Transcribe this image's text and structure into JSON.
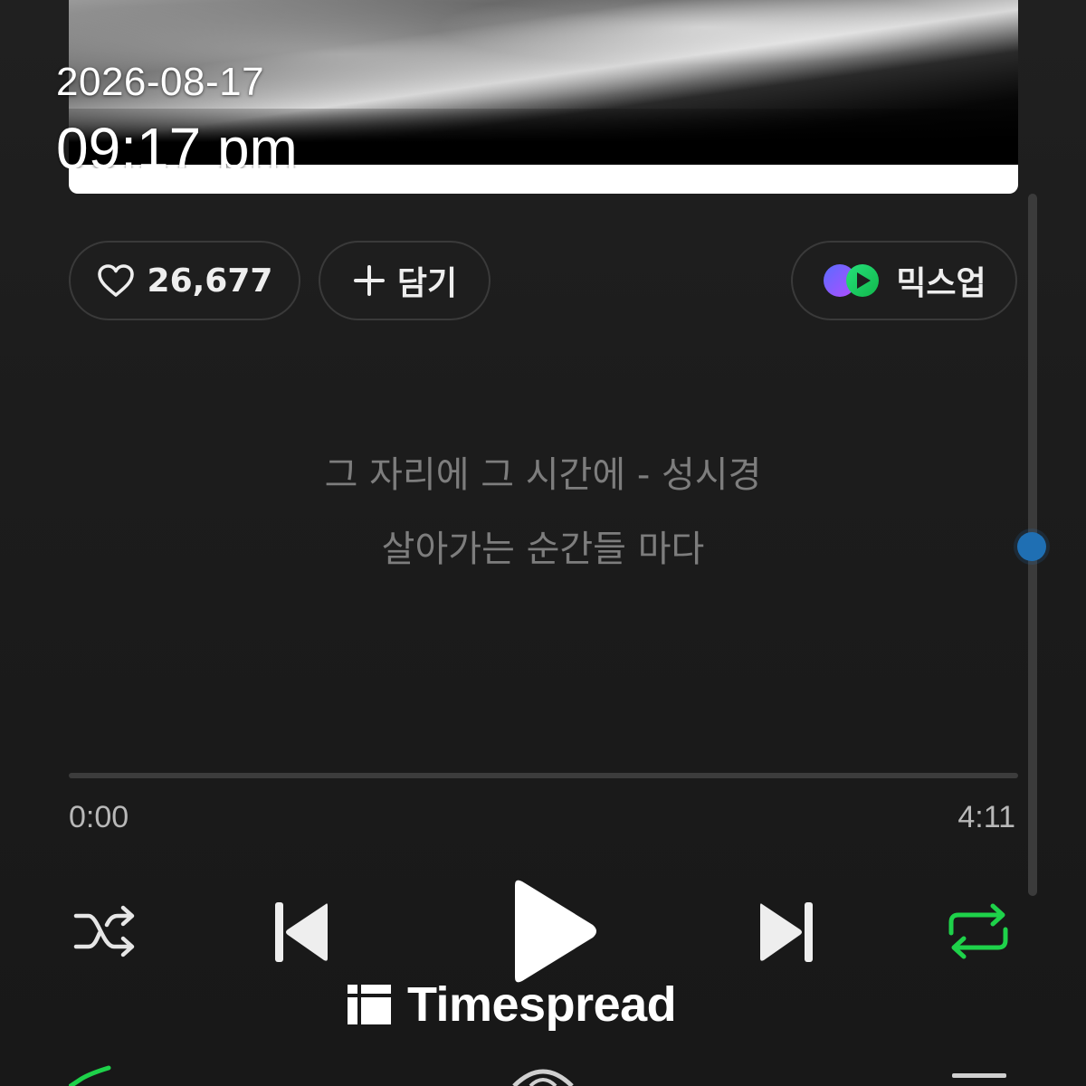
{
  "overlay": {
    "date": "2026-08-17",
    "time": "09:17 pm"
  },
  "actions": {
    "like_count": "26,677",
    "add_label": "담기",
    "mixup_label": "믹스업"
  },
  "lyrics": {
    "line1": "그 자리에 그 시간에 - 성시경",
    "line2": "살아가는 순간들 마다"
  },
  "playback": {
    "elapsed": "0:00",
    "total": "4:11",
    "progress": 0,
    "shuffle": false,
    "repeat": true
  },
  "watermark": {
    "text": "Timespread"
  },
  "colors": {
    "background": "#1b1b1b",
    "accent_green": "#1ed24a",
    "lyrics_text": "#7d7d7d",
    "scroll_knob": "#1f6fb3"
  },
  "icons": {
    "like": "heart-icon",
    "add": "plus-icon",
    "mixup": "mixup-logo-icon",
    "shuffle": "shuffle-icon",
    "prev": "skip-previous-icon",
    "play": "play-icon",
    "next": "skip-next-icon",
    "repeat": "repeat-icon"
  }
}
